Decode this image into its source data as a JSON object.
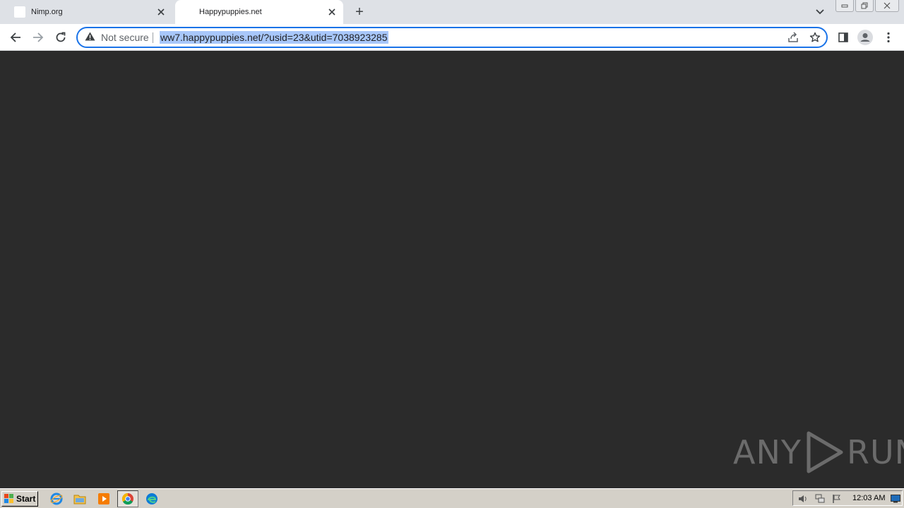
{
  "browser": {
    "tabs": [
      {
        "title": "Nimp.org",
        "active": false
      },
      {
        "title": "Happypuppies.net",
        "active": true
      }
    ],
    "new_tab_label": "+",
    "address_bar": {
      "security_label": "Not secure",
      "url": "ww7.happypuppies.net/?usid=23&utid=7038923285"
    }
  },
  "watermark": {
    "left_text": "ANY",
    "right_text": "RUN"
  },
  "taskbar": {
    "start_label": "Start",
    "apps": [
      "internet-explorer",
      "file-explorer",
      "media-player",
      "chrome",
      "edge"
    ],
    "clock": "12:03 AM"
  },
  "colors": {
    "page_background": "#2b2b2b",
    "tabstrip": "#dee1e6",
    "focus_ring": "#1a73e8",
    "url_selection": "#a8c7fa",
    "taskbar": "#d4d0c8"
  }
}
